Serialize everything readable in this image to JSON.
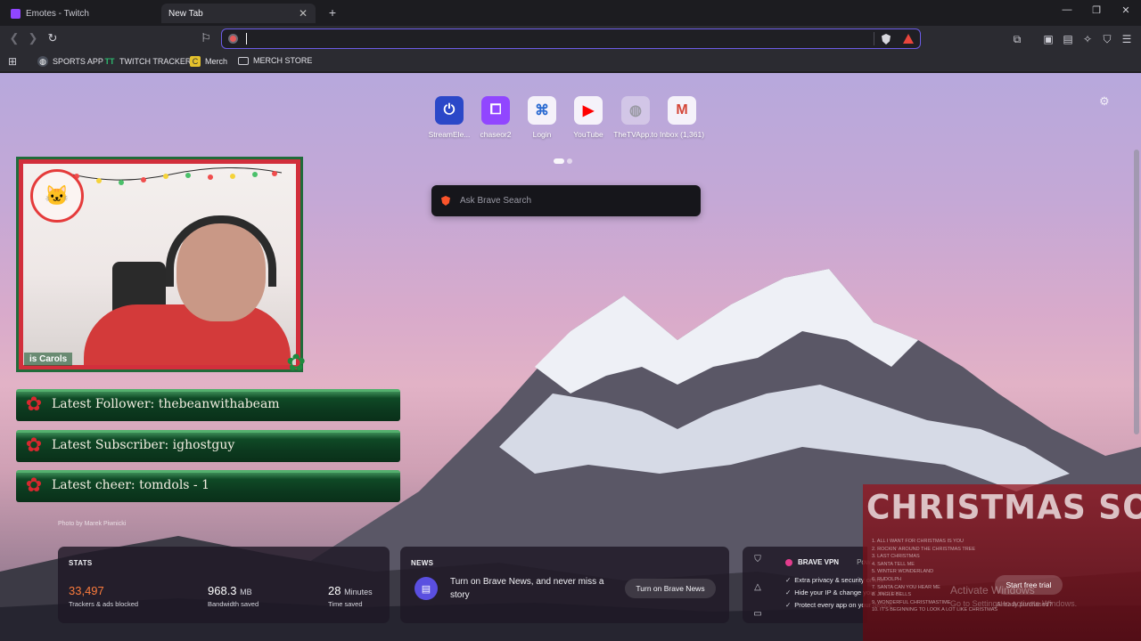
{
  "tabs": [
    {
      "title": "Emotes - Twitch",
      "favicon_color": "#9146ff",
      "active": false
    },
    {
      "title": "New Tab",
      "favicon_color": "",
      "active": true
    }
  ],
  "toolbar": {
    "address_value": "",
    "brave_shield_icon": "brave-shield-icon",
    "rewards_icon": "rewards-triangle-icon"
  },
  "bookmarks": [
    {
      "label": "SPORTS APP",
      "icon": "globe-icon",
      "color": "#4a8af4"
    },
    {
      "label": "TWITCH TRACKER",
      "icon": "tt-logo-icon",
      "color": "#2dbb70"
    },
    {
      "label": "Merch",
      "icon": "merch-icon",
      "color": "#e4c12c"
    },
    {
      "label": "MERCH STORE",
      "icon": "folder-icon",
      "color": "#cfcfd6"
    }
  ],
  "top_sites": [
    {
      "label": "StreamEle...",
      "icon": "streamelements-icon",
      "glyph": "⏻",
      "color": "#2b48c8"
    },
    {
      "label": "chaseor2",
      "icon": "twitch-icon",
      "glyph": "⧠",
      "color": "#9146ff"
    },
    {
      "label": "Login",
      "icon": "login-icon",
      "glyph": "⌘",
      "color": "#2a6ad1"
    },
    {
      "label": "YouTube",
      "icon": "youtube-icon",
      "glyph": "▶",
      "color": "#ff0000"
    },
    {
      "label": "TheTVApp.to",
      "icon": "globe-icon",
      "glyph": "◍",
      "color": "#9a9aa4"
    },
    {
      "label": "Inbox (1,361)",
      "icon": "gmail-icon",
      "glyph": "M",
      "color": "#d44638"
    }
  ],
  "search": {
    "placeholder": "Ask Brave Search"
  },
  "stream_overlay": {
    "caption": "is Carols",
    "latest_follower": "Latest Follower: thebeanwithabeam",
    "latest_subscriber": "Latest Subscriber: ighostguy",
    "latest_cheer": "Latest cheer: tomdols - 1"
  },
  "photo_credit": "Photo by Marek Piwnicki",
  "stats": {
    "title": "STATS",
    "trackers_value": "33,497",
    "trackers_color": "#fb7b3c",
    "trackers_label": "Trackers & ads blocked",
    "bandwidth_value": "968.3",
    "bandwidth_unit": "MB",
    "bandwidth_label": "Bandwidth saved",
    "time_value": "28",
    "time_unit": "Minutes",
    "time_label": "Time saved"
  },
  "news": {
    "title": "NEWS",
    "text": "Turn on Brave News, and never miss a story",
    "button": "Turn on Brave News"
  },
  "vpn": {
    "title": "BRAVE VPN",
    "powered": "Pow",
    "items": [
      "Extra privacy & security online",
      "Hide your IP & change your location",
      "Protect every app on your device"
    ]
  },
  "christmas": {
    "heading": "CHRISTMAS SONGS",
    "songs": [
      "1. ALL I WANT FOR CHRISTMAS IS YOU",
      "2. ROCKIN' AROUND THE CHRISTMAS TREE",
      "3. LAST CHRISTMAS",
      "4. SANTA TELL ME",
      "5. WINTER WONDERLAND",
      "6. RUDOLPH",
      "7. SANTA CAN YOU HEAR ME",
      "8. JINGLE BELLS",
      "9. WONDERFUL CHRISTMASTIME",
      "10. IT'S BEGINNING TO LOOK A LOT LIKE CHRISTMAS"
    ],
    "activate": "Activate Windows",
    "goto": "Go to Settings to activate Windows.",
    "trial_button": "Start free trial",
    "already": "Already purchased?"
  }
}
